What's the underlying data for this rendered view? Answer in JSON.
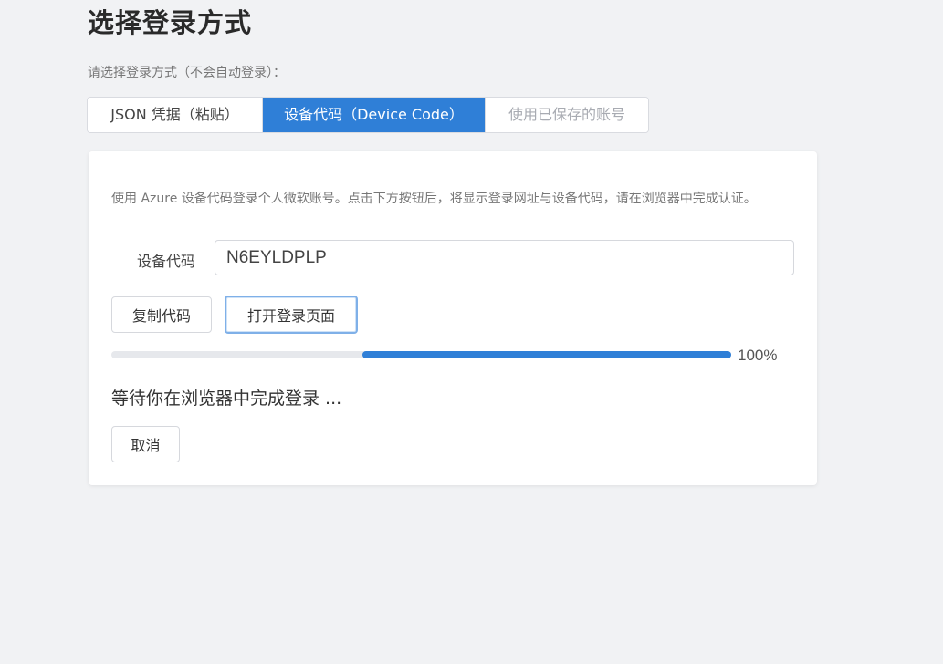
{
  "header": {
    "title": "选择登录方式",
    "subtitle": "请选择登录方式（不会自动登录）："
  },
  "tabs": [
    {
      "label": "JSON 凭据（粘贴）",
      "active": false
    },
    {
      "label": "设备代码（Device Code）",
      "active": true
    },
    {
      "label": "使用已保存的账号",
      "active": false
    }
  ],
  "device_code": {
    "description": "使用 Azure 设备代码登录个人微软账号。点击下方按钮后，将显示登录网址与设备代码，请在浏览器中完成认证。",
    "field_label": "设备代码",
    "code_value": "N6EYLDPLP",
    "copy_button": "复制代码",
    "open_button": "打开登录页面",
    "progress": {
      "value_percent": 100,
      "label": "100%"
    },
    "status_text": "等待你在浏览器中完成登录 ...",
    "cancel_button": "取消"
  },
  "colors": {
    "accent": "#2f7fd7",
    "background": "#f1f2f4",
    "card": "#ffffff"
  }
}
